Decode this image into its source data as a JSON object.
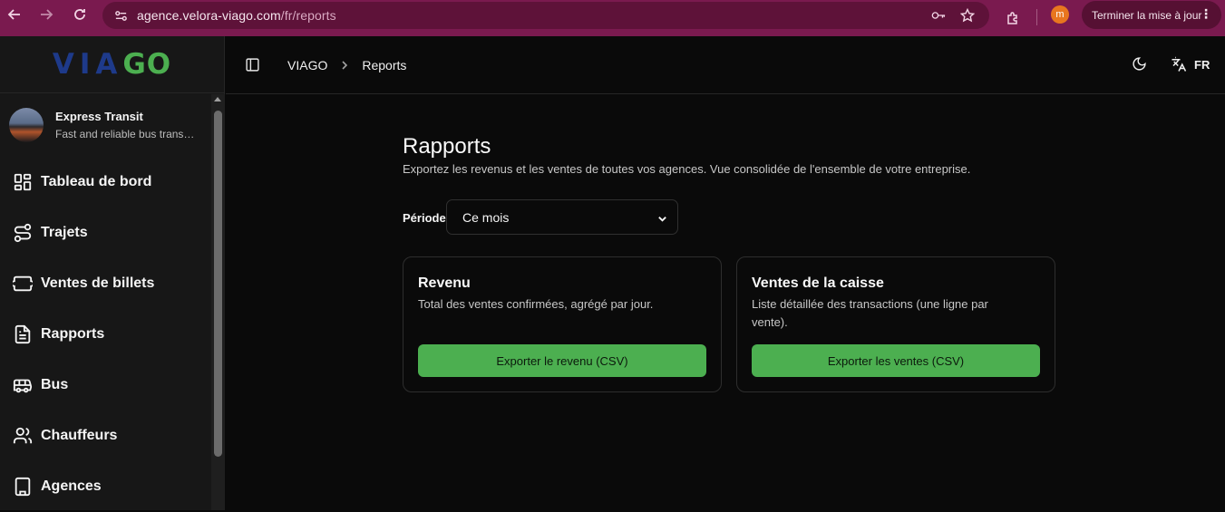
{
  "browser": {
    "url_host": "agence.velora-viago.com",
    "url_path": "/fr/reports",
    "profile_initial": "m",
    "update_label": "Terminer la mise à jour",
    "theme_color": "#7a1a4f"
  },
  "sidebar": {
    "logo_via": "VIA",
    "logo_go": "GO",
    "org_name": "Express Transit",
    "org_desc": "Fast and reliable bus transp...",
    "items": [
      {
        "label": "Tableau de bord",
        "icon": "dashboard-icon"
      },
      {
        "label": "Trajets",
        "icon": "route-icon"
      },
      {
        "label": "Ventes de billets",
        "icon": "ticket-icon"
      },
      {
        "label": "Rapports",
        "icon": "file-text-icon"
      },
      {
        "label": "Bus",
        "icon": "bus-icon"
      },
      {
        "label": "Chauffeurs",
        "icon": "users-icon"
      },
      {
        "label": "Agences",
        "icon": "building-icon"
      }
    ]
  },
  "header": {
    "breadcrumb_root": "VIAGO",
    "breadcrumb_current": "Reports",
    "language": "FR"
  },
  "main": {
    "title": "Rapports",
    "subtitle": "Exportez les revenus et les ventes de toutes vos agences. Vue consolidée de l'ensemble de votre entreprise.",
    "period_label": "Période",
    "period_value": "Ce mois",
    "cards": [
      {
        "title": "Revenu",
        "desc": "Total des ventes confirmées, agrégé par jour.",
        "button": "Exporter le revenu (CSV)"
      },
      {
        "title": "Ventes de la caisse",
        "desc": "Liste détaillée des transactions (une ligne par vente).",
        "button": "Exporter les ventes (CSV)"
      }
    ]
  },
  "colors": {
    "accent": "#4caf50",
    "logo_blue": "#1e3a8a",
    "background": "#0a0a0a"
  }
}
